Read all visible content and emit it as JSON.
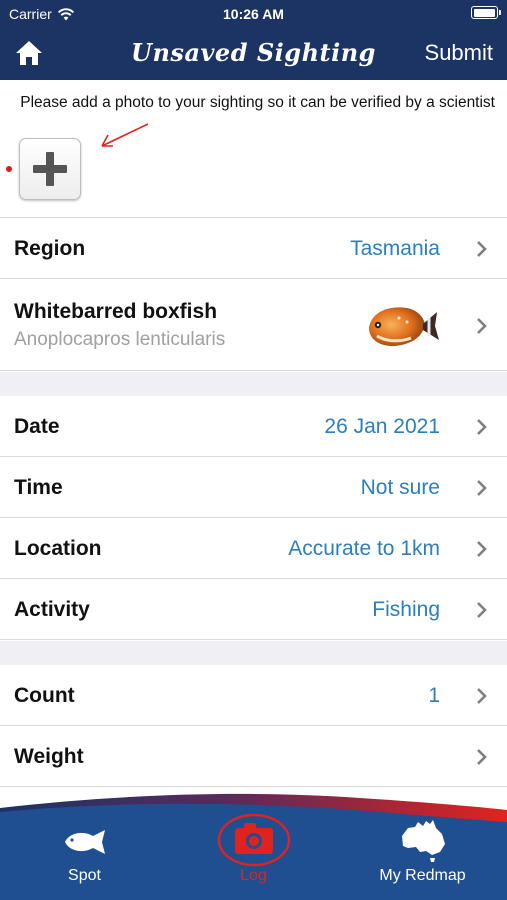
{
  "status_bar": {
    "carrier": "Carrier",
    "time": "10:26 AM"
  },
  "nav": {
    "title": "Unsaved Sighting",
    "submit_label": "Submit"
  },
  "photo": {
    "hint": "Please add a photo to your sighting so it can be verified by a scientist"
  },
  "region": {
    "label": "Region",
    "value": "Tasmania"
  },
  "species": {
    "common_name": "Whitebarred boxfish",
    "scientific_name": "Anoplocapros lenticularis"
  },
  "details": [
    {
      "label": "Date",
      "value": "26 Jan 2021"
    },
    {
      "label": "Time",
      "value": "Not sure"
    },
    {
      "label": "Location",
      "value": "Accurate to 1km"
    },
    {
      "label": "Activity",
      "value": "Fishing"
    }
  ],
  "measurements": [
    {
      "label": "Count",
      "value": "1"
    },
    {
      "label": "Weight",
      "value": ""
    }
  ],
  "tabs": [
    {
      "label": "Spot",
      "icon": "fish-icon",
      "active": false
    },
    {
      "label": "Log",
      "icon": "camera-icon",
      "active": true
    },
    {
      "label": "My Redmap",
      "icon": "australia-map-icon",
      "active": false
    }
  ],
  "colors": {
    "nav_bg": "#1b3464",
    "value_text": "#2b7ec0",
    "active_tab": "#e0231f",
    "section_gap": "#efeff4"
  }
}
